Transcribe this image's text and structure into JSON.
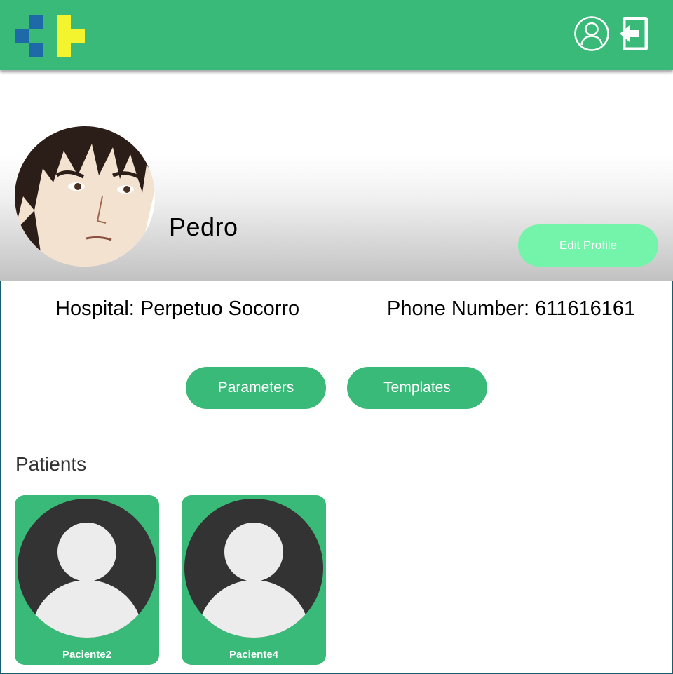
{
  "colors": {
    "primary": "#3aba78",
    "primary_light": "#74f4aa",
    "logo_blue": "#1e6aa9",
    "logo_yellow": "#f4f42e",
    "placeholder_dark": "#333333",
    "placeholder_light": "#ececec"
  },
  "header": {
    "logo": "app-logo",
    "icons": [
      "user-profile-icon",
      "logout-icon"
    ]
  },
  "profile": {
    "name": "Pedro",
    "edit_label": "Edit Profile",
    "hospital": "Hospital: Perpetuo Socorro",
    "phone": "Phone Number: 611616161"
  },
  "actions": {
    "parameters": "Parameters",
    "templates": "Templates"
  },
  "patients": {
    "title": "Patients",
    "items": [
      {
        "name": "Paciente2"
      },
      {
        "name": "Paciente4"
      }
    ]
  }
}
